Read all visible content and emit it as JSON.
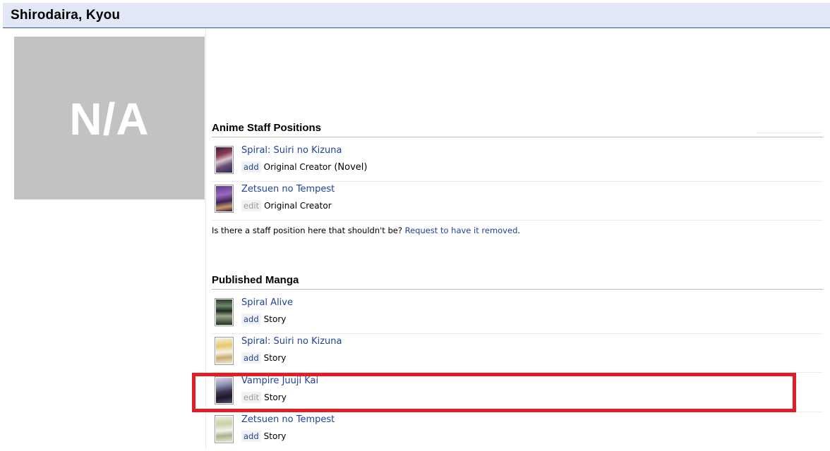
{
  "page": {
    "title": "Shirodaira, Kyou",
    "image_placeholder": "N/A"
  },
  "anime_staff": {
    "heading": "Anime Staff Positions",
    "items": [
      {
        "title": "Spiral: Suiri no Kizuna",
        "action": "add",
        "role": "Original Creator",
        "role_extra": " (Novel)"
      },
      {
        "title": "Zetsuen no Tempest",
        "action": "edit",
        "role": "Original Creator",
        "role_extra": ""
      }
    ],
    "note_text": "Is there a staff position here that shouldn't be? ",
    "note_link": "Request to have it removed",
    "note_end": "."
  },
  "manga": {
    "heading": "Published Manga",
    "items": [
      {
        "title": "Spiral Alive",
        "action": "add",
        "role": "Story"
      },
      {
        "title": "Spiral: Suiri no Kizuna",
        "action": "add",
        "role": "Story"
      },
      {
        "title": "Vampire Juuji Kai",
        "action": "edit",
        "role": "Story"
      },
      {
        "title": "Zetsuen no Tempest",
        "action": "add",
        "role": "Story"
      }
    ]
  },
  "colors": {
    "header_bg": "#e1e7f5",
    "link": "#1d439b",
    "highlight": "#e21d25"
  }
}
